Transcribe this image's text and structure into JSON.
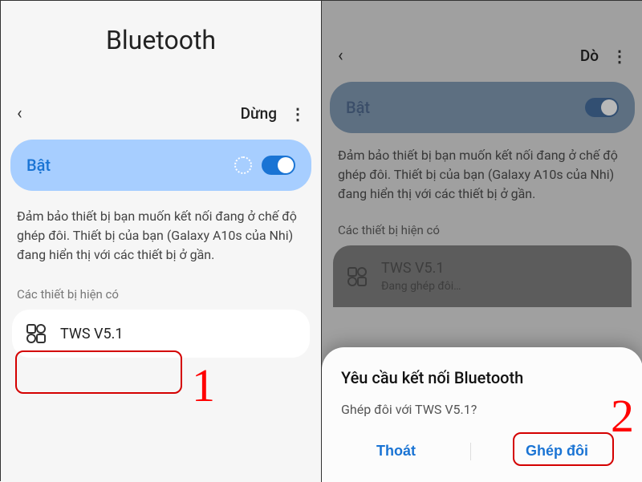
{
  "left": {
    "title": "Bluetooth",
    "stop_label": "Dừng",
    "toggle_label": "Bật",
    "info_text": "Đảm bảo thiết bị bạn muốn kết nối đang ở chế độ ghép đôi. Thiết bị của bạn (Galaxy A10s của Nhi) đang hiển thị với các thiết bị ở gần.",
    "section_label": "Các thiết bị hiện có",
    "device_name": "TWS V5.1"
  },
  "right": {
    "scan_label": "Dò",
    "toggle_label": "Bật",
    "info_text": "Đảm bảo thiết bị bạn muốn kết nối đang ở chế độ ghép đôi. Thiết bị của bạn (Galaxy A10s của Nhi) đang hiển thị với các thiết bị ở gần.",
    "section_label": "Các thiết bị hiện có",
    "device_name": "TWS V5.1",
    "device_status": "Đang ghép đôi…",
    "dialog": {
      "title": "Yêu cầu kết nối Bluetooth",
      "message": "Ghép đôi với TWS V5.1?",
      "cancel": "Thoát",
      "confirm": "Ghép đôi"
    }
  },
  "annotation": {
    "step1": "1",
    "step2": "2"
  }
}
